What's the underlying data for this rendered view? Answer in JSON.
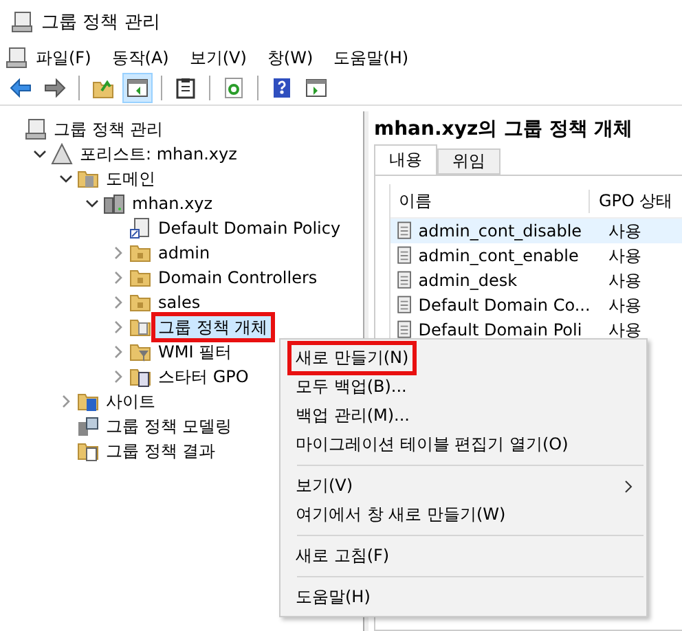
{
  "window": {
    "title": "그룹 정책 관리"
  },
  "menu_bar": [
    "파일(F)",
    "동작(A)",
    "보기(V)",
    "창(W)",
    "도움말(H)"
  ],
  "toolbar": [
    {
      "kind": "back",
      "selected": false
    },
    {
      "kind": "forward",
      "selected": false
    },
    {
      "kind": "separator"
    },
    {
      "kind": "up",
      "selected": false
    },
    {
      "kind": "tree-toggle",
      "selected": true
    },
    {
      "kind": "separator"
    },
    {
      "kind": "clipboard",
      "selected": false
    },
    {
      "kind": "separator"
    },
    {
      "kind": "refresh",
      "selected": false
    },
    {
      "kind": "separator"
    },
    {
      "kind": "help",
      "selected": false
    },
    {
      "kind": "pane",
      "selected": false
    }
  ],
  "tree": [
    {
      "label": "그룹 정책 관리",
      "kind": "console",
      "selected": false,
      "highlighted": false,
      "children": [
        {
          "label": "포리스트: mhan.xyz",
          "kind": "forest",
          "expanded": true,
          "selected": false,
          "highlighted": false,
          "children": [
            {
              "label": "도메인",
              "kind": "domains",
              "expanded": true,
              "selected": false,
              "highlighted": false,
              "children": [
                {
                  "label": "mhan.xyz",
                  "kind": "domain",
                  "expanded": true,
                  "selected": false,
                  "highlighted": false,
                  "children": [
                    {
                      "label": "Default Domain Policy",
                      "kind": "gpo-link",
                      "selected": false,
                      "highlighted": false
                    },
                    {
                      "label": "admin",
                      "kind": "ou",
                      "expanded": false,
                      "selected": false,
                      "highlighted": false
                    },
                    {
                      "label": "Domain Controllers",
                      "kind": "ou",
                      "expanded": false,
                      "selected": false,
                      "highlighted": false
                    },
                    {
                      "label": "sales",
                      "kind": "ou",
                      "expanded": false,
                      "selected": false,
                      "highlighted": false
                    },
                    {
                      "label": "그룹 정책 개체",
                      "kind": "gpo-folder",
                      "expanded": false,
                      "selected": true,
                      "highlighted": true
                    },
                    {
                      "label": "WMI 필터",
                      "kind": "filter-folder",
                      "expanded": false,
                      "selected": false,
                      "highlighted": false
                    },
                    {
                      "label": "스타터 GPO",
                      "kind": "starter-folder",
                      "expanded": false,
                      "selected": false,
                      "highlighted": false
                    }
                  ]
                }
              ]
            },
            {
              "label": "사이트",
              "kind": "sites",
              "expanded": false,
              "selected": false,
              "highlighted": false
            },
            {
              "label": "그룹 정책 모델링",
              "kind": "modeling",
              "selected": false,
              "highlighted": false
            },
            {
              "label": "그룹 정책 결과",
              "kind": "results",
              "selected": false,
              "highlighted": false
            }
          ]
        }
      ]
    }
  ],
  "details": {
    "title": "mhan.xyz의 그룹 정책 개체",
    "tabs": [
      {
        "label": "내용",
        "selected": true
      },
      {
        "label": "위임",
        "selected": false
      }
    ],
    "columns": [
      "이름",
      "GPO 상태"
    ],
    "rows": [
      {
        "name": "admin_cont_disable",
        "status": "사용",
        "selected": true
      },
      {
        "name": "admin_cont_enable",
        "status": "사용",
        "selected": false
      },
      {
        "name": "admin_desk",
        "status": "사용",
        "selected": false
      },
      {
        "name": "Default Domain Co...",
        "status": "사용",
        "selected": false
      },
      {
        "name": "Default Domain Poli",
        "status": "사용",
        "selected": false
      }
    ]
  },
  "context_menu": [
    {
      "kind": "item",
      "label": "새로 만들기(N)",
      "highlighted": true
    },
    {
      "kind": "item",
      "label": "모두 백업(B)...",
      "highlighted": false
    },
    {
      "kind": "item",
      "label": "백업 관리(M)...",
      "highlighted": false
    },
    {
      "kind": "item",
      "label": "마이그레이션 테이블 편집기 열기(O)",
      "highlighted": false
    },
    {
      "kind": "separator"
    },
    {
      "kind": "submenu",
      "label": "보기(V)",
      "highlighted": false
    },
    {
      "kind": "item",
      "label": "여기에서 창 새로 만들기(W)",
      "highlighted": false
    },
    {
      "kind": "separator"
    },
    {
      "kind": "item",
      "label": "새로 고침(F)",
      "highlighted": false
    },
    {
      "kind": "separator"
    },
    {
      "kind": "item",
      "label": "도움말(H)",
      "highlighted": false
    }
  ]
}
